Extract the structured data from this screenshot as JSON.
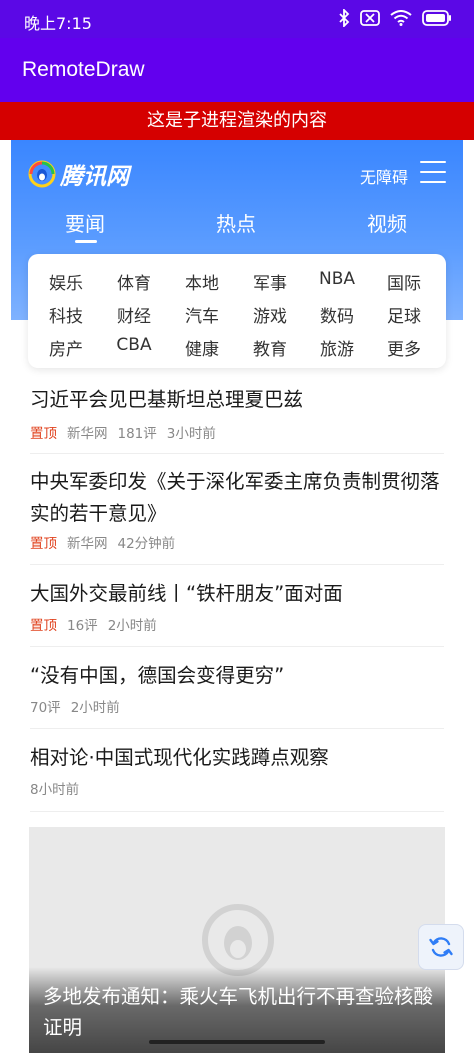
{
  "status_bar": {
    "time": "晚上7:15",
    "icons": [
      "bluetooth-icon",
      "no-sim-icon",
      "wifi-icon",
      "battery-icon"
    ]
  },
  "app_bar": {
    "title": "RemoteDraw"
  },
  "banner": {
    "text": "这是子进程渲染的内容"
  },
  "site": {
    "brand": "腾讯网",
    "accessibility": "无障碍",
    "tabs": [
      {
        "label": "要闻",
        "active": true
      },
      {
        "label": "热点"
      },
      {
        "label": "视频"
      }
    ],
    "categories": [
      [
        "娱乐",
        "体育",
        "本地",
        "军事",
        "NBA",
        "国际"
      ],
      [
        "科技",
        "财经",
        "汽车",
        "游戏",
        "数码",
        "足球"
      ],
      [
        "房产",
        "CBA",
        "健康",
        "教育",
        "旅游",
        "更多"
      ]
    ]
  },
  "news": [
    {
      "title": "习近平会见巴基斯坦总理夏巴兹",
      "pin": "置顶",
      "source": "新华网",
      "comments": "181评",
      "time": "3小时前"
    },
    {
      "title": "中央军委印发《关于深化军委主席负责制贯彻落实的若干意见》",
      "pin": "置顶",
      "source": "新华网",
      "time": "42分钟前"
    },
    {
      "title": "大国外交最前线丨“铁杆朋友”面对面",
      "pin": "置顶",
      "comments": "16评",
      "time": "2小时前"
    },
    {
      "title": "“没有中国，德国会变得更穷”",
      "comments": "70评",
      "time": "2小时前"
    },
    {
      "title": "相对论·中国式现代化实践蹲点观察",
      "time": "8小时前"
    }
  ],
  "image_card": {
    "caption": "多地发布通知：乘火车飞机出行不再查验核酸证明"
  },
  "colors": {
    "app_bar": "#6200ee",
    "status_bar": "#5b08e6",
    "banner": "#d50000",
    "hero": "#3a86ff",
    "pin": "#e0431f"
  }
}
